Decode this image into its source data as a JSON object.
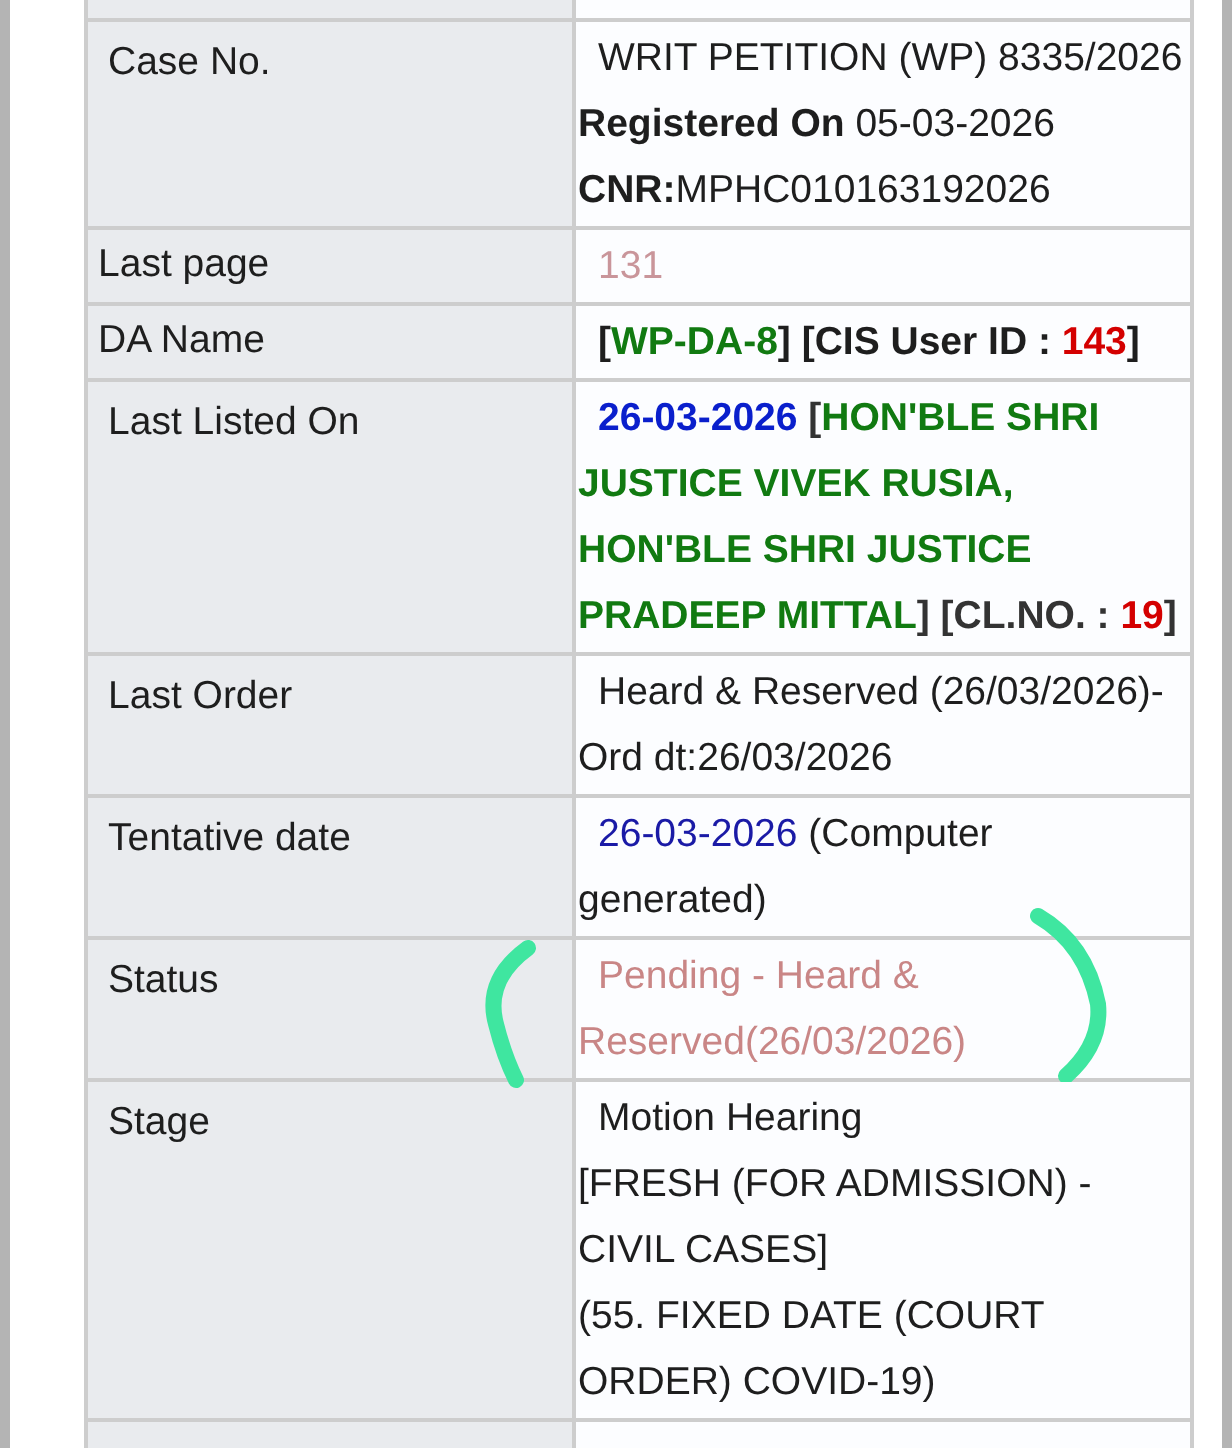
{
  "rows": [
    {
      "label": "Case No.",
      "kind": "normal",
      "lines": [
        [
          {
            "kind": "plain",
            "text": "WRIT PETITION (WP) 8335/2026 "
          },
          {
            "kind": "bold",
            "text": "Registered On"
          },
          {
            "kind": "plain",
            "text": " 05-03-2026 "
          },
          {
            "kind": "bold",
            "text": "CNR:"
          },
          {
            "kind": "plain",
            "text": "MPHC010163192026"
          }
        ]
      ]
    },
    {
      "label": "Last page",
      "kind": "light",
      "lines": [
        [
          {
            "kind": "faded",
            "text": "131"
          }
        ]
      ]
    },
    {
      "label": "DA Name",
      "kind": "light",
      "lines": [
        [
          {
            "kind": "bold",
            "text": "["
          },
          {
            "kind": "green",
            "text": "WP-DA-8"
          },
          {
            "kind": "bold",
            "text": "] [CIS User ID : "
          },
          {
            "kind": "red",
            "text": "143"
          },
          {
            "kind": "bold",
            "text": "]"
          }
        ]
      ]
    },
    {
      "label": "Last Listed On",
      "kind": "normal",
      "lines": [
        [
          {
            "kind": "blue",
            "text": "26-03-2026"
          },
          {
            "kind": "bracket",
            "text": " ["
          },
          {
            "kind": "green",
            "text": "HON'BLE SHRI JUSTICE VIVEK RUSIA, HON'BLE SHRI JUSTICE PRADEEP MITTAL"
          },
          {
            "kind": "bracket",
            "text": "] [CL.NO. : "
          },
          {
            "kind": "red",
            "text": "19"
          },
          {
            "kind": "bracket",
            "text": "]"
          }
        ]
      ]
    },
    {
      "label": "Last Order",
      "kind": "normal",
      "lines": [
        [
          {
            "kind": "plain",
            "text": "Heard & Reserved (26/03/2026)-Ord dt:26/03/2026"
          }
        ]
      ]
    },
    {
      "label": "Tentative date",
      "kind": "normal",
      "lines": [
        [
          {
            "kind": "link",
            "text": "26-03-2026"
          },
          {
            "kind": "plain",
            "text": " (Computer generated)"
          }
        ]
      ]
    },
    {
      "label": "Status",
      "kind": "normal",
      "annotated": true,
      "lines": [
        [
          {
            "kind": "status",
            "text": "Pending - Heard & Reserved(26/03/2026)"
          }
        ]
      ]
    },
    {
      "label": "Stage",
      "kind": "normal",
      "lines": [
        [
          {
            "kind": "plain",
            "text": "Motion Hearing"
          }
        ],
        [
          {
            "kind": "plain",
            "text": "[FRESH (FOR ADMISSION) - CIVIL CASES]"
          }
        ],
        [
          {
            "kind": "plain",
            "text": "(55. FIXED DATE (COURT ORDER) COVID-19)"
          }
        ]
      ]
    }
  ]
}
